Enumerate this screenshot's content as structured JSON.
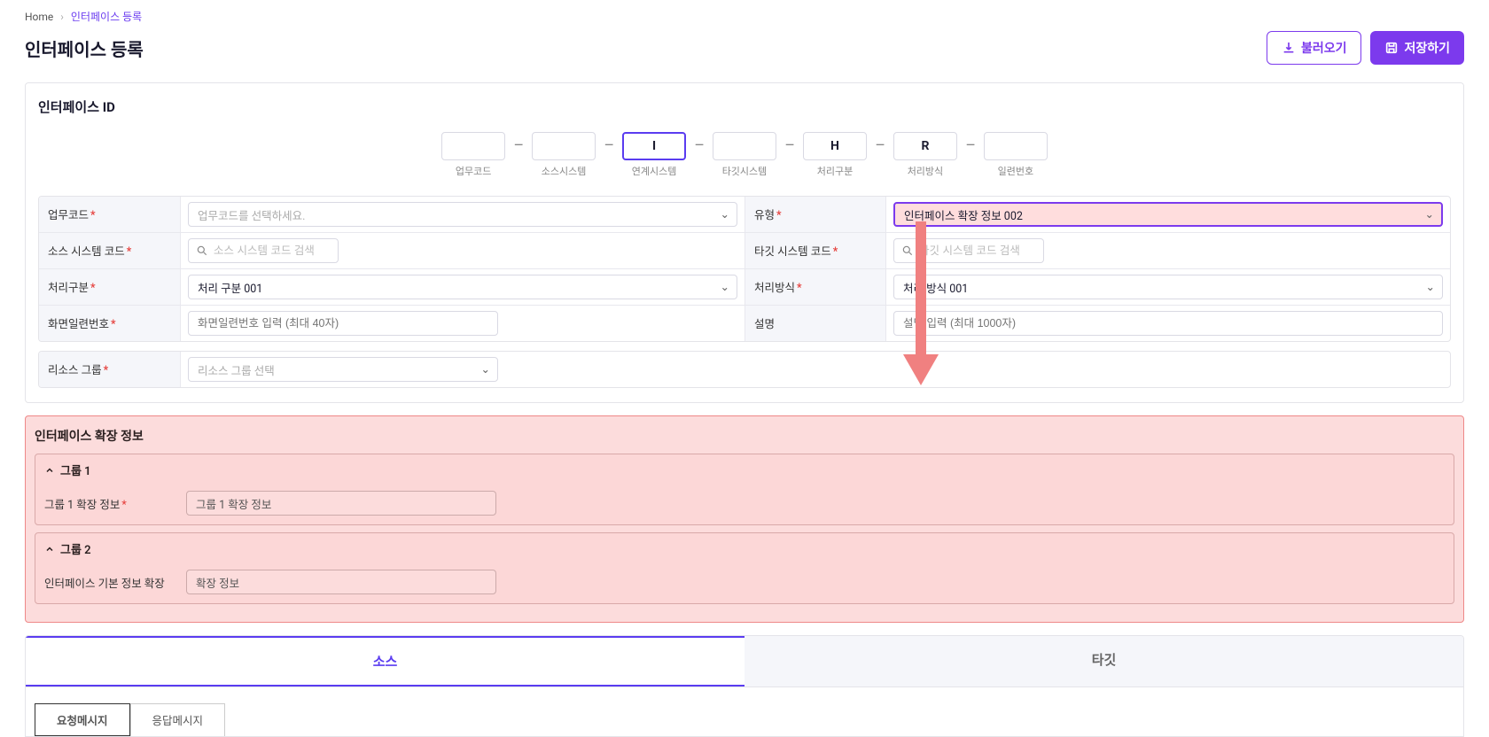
{
  "breadcrumb": {
    "home": "Home",
    "current": "인터페이스 등록"
  },
  "title": "인터페이스 등록",
  "buttons": {
    "load": "불러오기",
    "save": "저장하기"
  },
  "id_section": {
    "label": "인터페이스 ID",
    "boxes": [
      {
        "value": "",
        "label": "업무코드"
      },
      {
        "value": "",
        "label": "소스시스템"
      },
      {
        "value": "I",
        "label": "연계시스템"
      },
      {
        "value": "",
        "label": "타깃시스템"
      },
      {
        "value": "H",
        "label": "처리구분"
      },
      {
        "value": "R",
        "label": "처리방식"
      },
      {
        "value": "",
        "label": "일련번호"
      }
    ]
  },
  "fields": {
    "biz_code": {
      "label": "업무코드",
      "placeholder": "업무코드를 선택하세요."
    },
    "type": {
      "label": "유형",
      "value": "인터페이스 확장 정보 002"
    },
    "source_sys": {
      "label": "소스 시스템 코드",
      "placeholder": "소스 시스템 코드 검색"
    },
    "target_sys": {
      "label": "타깃 시스템 코드",
      "placeholder": "타깃 시스템 코드 검색"
    },
    "proc_div": {
      "label": "처리구분",
      "value": "처리 구분 001"
    },
    "proc_method": {
      "label": "처리방식",
      "value": "처리 방식 001"
    },
    "serial": {
      "label": "화면일련번호",
      "placeholder": "화면일련번호 입력 (최대 40자)"
    },
    "desc": {
      "label": "설명",
      "placeholder": "설명 입력 (최대 1000자)"
    },
    "resource": {
      "label": "리소스 그룹",
      "placeholder": "리소스 그룹 선택"
    }
  },
  "ext_section": {
    "title": "인터페이스 확장 정보",
    "group1": {
      "head": "그룹 1",
      "label": "그룹 1 확장 정보",
      "value": "그룹 1 확장 정보"
    },
    "group2": {
      "head": "그룹 2",
      "label": "인터페이스 기본 정보 확장",
      "value": "확장 정보"
    }
  },
  "tabs": {
    "source": "소스",
    "target": "타깃"
  },
  "subtabs": {
    "req": "요청메시지",
    "res": "응답메시지"
  }
}
